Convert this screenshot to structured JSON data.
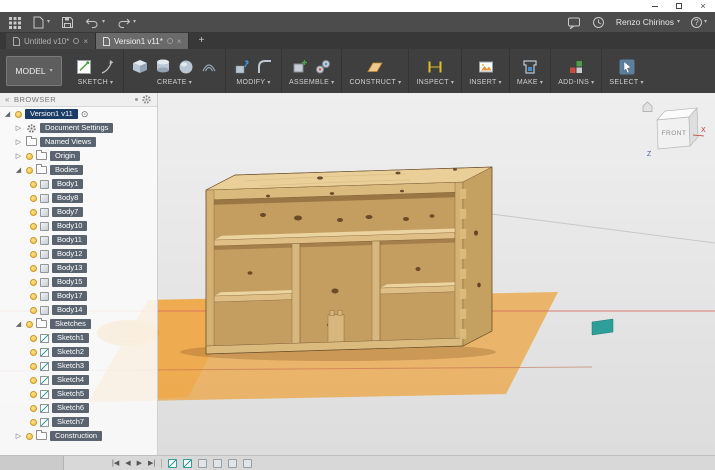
{
  "ui": {
    "icons": {
      "caret": "▾",
      "collapsed": "▷",
      "expanded": "◢",
      "close": "×",
      "plus": "+",
      "double_chevron_left": "«",
      "circle_dot": "⊙"
    }
  },
  "titlebar": {
    "user": "Renzo Chirinos",
    "help": "?"
  },
  "tabs": [
    {
      "title": "Untitled v10*"
    },
    {
      "title": "Version1 v11*"
    }
  ],
  "toolbar": {
    "workspace": "MODEL",
    "groups": [
      {
        "label": "SKETCH"
      },
      {
        "label": "CREATE"
      },
      {
        "label": "MODIFY"
      },
      {
        "label": "ASSEMBLE"
      },
      {
        "label": "CONSTRUCT"
      },
      {
        "label": "INSPECT"
      },
      {
        "label": "INSERT"
      },
      {
        "label": "MAKE"
      },
      {
        "label": "ADD-INS"
      },
      {
        "label": "SELECT"
      }
    ]
  },
  "browser": {
    "header": "BROWSER",
    "root_label": "Version1 v11",
    "nodes": {
      "document_settings": "Document Settings",
      "named_views": "Named Views",
      "origin": "Origin",
      "bodies": "Bodies",
      "sketches": "Sketches",
      "construction": "Construction"
    },
    "bodies": [
      "Body1",
      "Body8",
      "Body7",
      "Body10",
      "Body11",
      "Body12",
      "Body13",
      "Body15",
      "Body17",
      "Body14"
    ],
    "sketches": [
      "Sketch1",
      "Sketch2",
      "Sketch3",
      "Sketch4",
      "Sketch5",
      "Sketch6",
      "Sketch7"
    ]
  },
  "viewcube": {
    "face": "FRONT",
    "axis_x": "X",
    "axis_z": "Z"
  },
  "timeline": {
    "controls": [
      "|◀",
      "◀",
      "▶",
      "▶|"
    ]
  },
  "colors": {
    "ground": "#ECA648",
    "wood": "#D7B77C",
    "axis_red": "#D96C5F",
    "teal_object": "#2E9E98"
  }
}
